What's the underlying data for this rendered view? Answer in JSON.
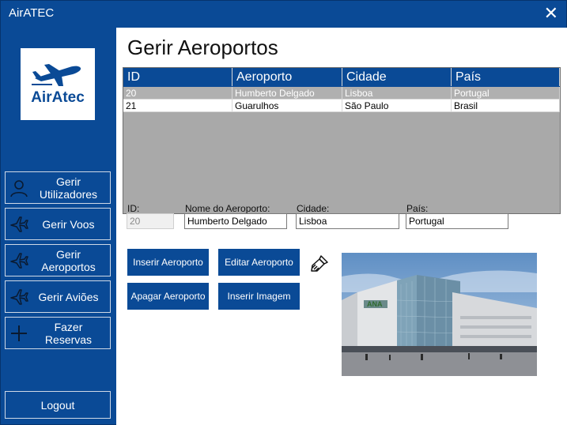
{
  "window": {
    "title": "AirATEC",
    "close_glyph": "✕"
  },
  "logo": {
    "text": "AirAtec",
    "icon": "airplane-icon",
    "color": "#0a4a96"
  },
  "sidebar": {
    "items": [
      {
        "label": "Gerir Utilizadores",
        "icon": "user-icon"
      },
      {
        "label": "Gerir Voos",
        "icon": "airplane-icon"
      },
      {
        "label": "Gerir Aeroportos",
        "icon": "airplane-icon"
      },
      {
        "label": "Gerir Aviões",
        "icon": "airplane-icon"
      },
      {
        "label": "Fazer Reservas",
        "icon": "plus-icon"
      }
    ],
    "logout": "Logout"
  },
  "main": {
    "title": "Gerir Aeroportos"
  },
  "table": {
    "columns": [
      "ID",
      "Aeroporto",
      "Cidade",
      "País"
    ],
    "rows": [
      [
        "20",
        "Humberto Delgado",
        "Lisboa",
        "Portugal"
      ],
      [
        "21",
        "Guarulhos",
        "São Paulo",
        "Brasil"
      ]
    ],
    "selected_row": 0
  },
  "form": {
    "id_label": "ID:",
    "id_value": "20",
    "name_label": "Nome do Aeroporto:",
    "name_value": "Humberto Delgado",
    "city_label": "Cidade:",
    "city_value": "Lisboa",
    "country_label": "País:",
    "country_value": "Portugal"
  },
  "actions": {
    "insert": "Inserir Aeroporto",
    "edit": "Editar Aeroporto",
    "delete": "Apagar Aeroporto",
    "insert_image": "Inserir Imagem",
    "clear_icon": "brush-icon"
  },
  "colors": {
    "accent": "#0a4a96",
    "grid_background": "#a9a9a9",
    "selected_row": "#b0b0b0"
  }
}
